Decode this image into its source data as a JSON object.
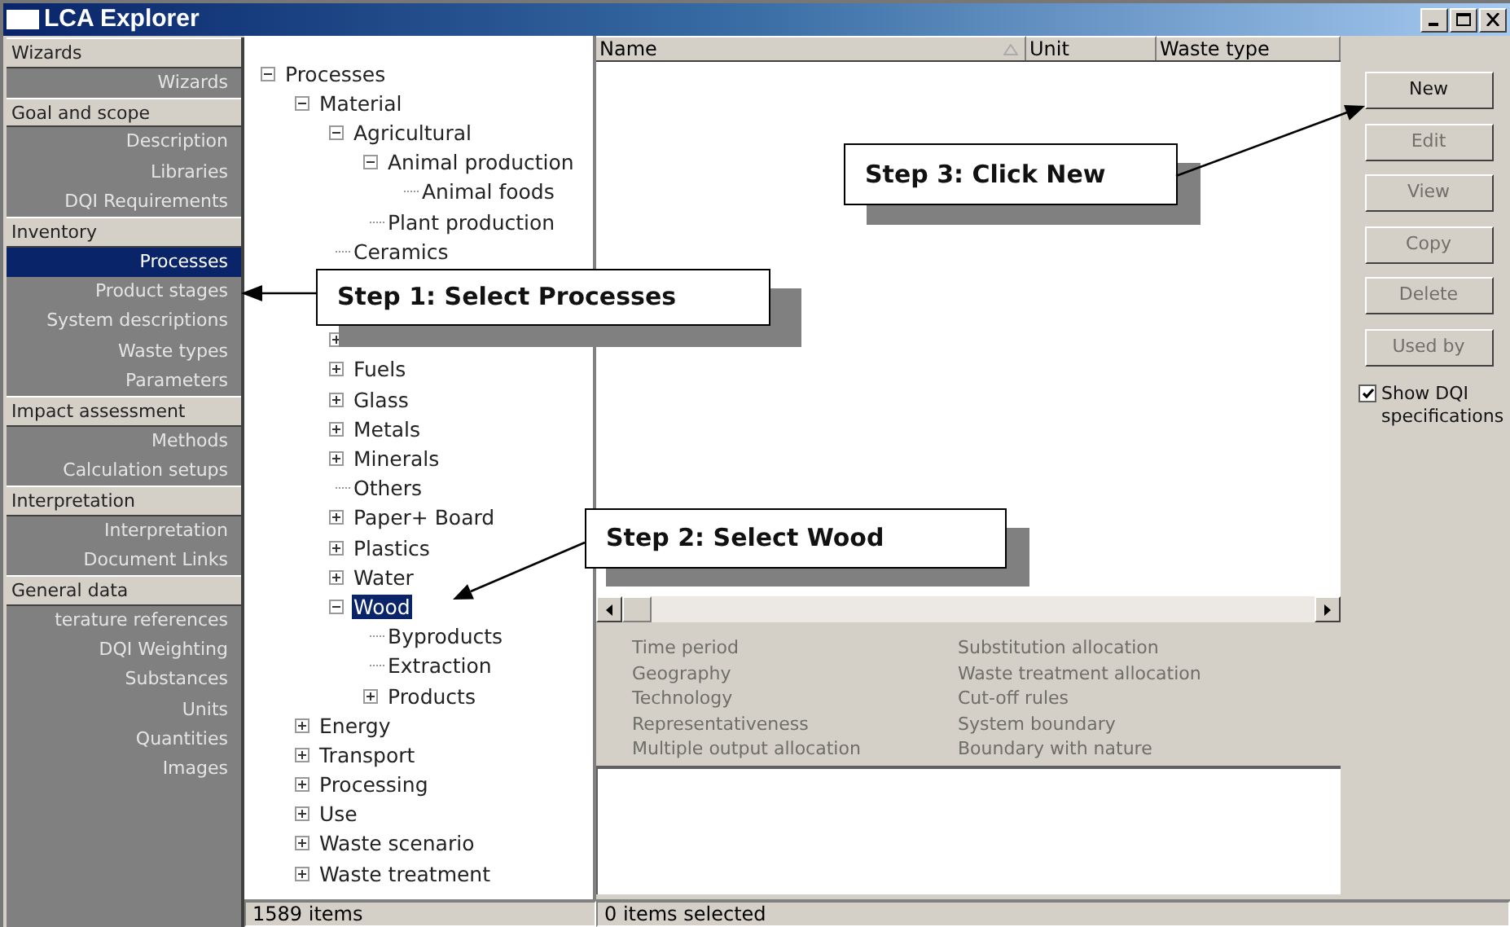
{
  "window": {
    "title": "LCA Explorer"
  },
  "sidebar": [
    {
      "title": "Wizards",
      "items": [
        {
          "label": "Wizards",
          "selected": false
        }
      ]
    },
    {
      "title": "Goal and scope",
      "items": [
        {
          "label": "Description",
          "selected": false
        },
        {
          "label": "Libraries",
          "selected": false
        },
        {
          "label": "DQI Requirements",
          "selected": false
        }
      ]
    },
    {
      "title": "Inventory",
      "items": [
        {
          "label": "Processes",
          "selected": true
        },
        {
          "label": "Product stages",
          "selected": false
        },
        {
          "label": "System descriptions",
          "selected": false
        },
        {
          "label": "Waste types",
          "selected": false
        },
        {
          "label": "Parameters",
          "selected": false
        }
      ]
    },
    {
      "title": "Impact assessment",
      "items": [
        {
          "label": "Methods",
          "selected": false
        },
        {
          "label": "Calculation setups",
          "selected": false
        }
      ]
    },
    {
      "title": "Interpretation",
      "items": [
        {
          "label": "Interpretation",
          "selected": false
        },
        {
          "label": "Document Links",
          "selected": false
        }
      ]
    },
    {
      "title": "General data",
      "items": [
        {
          "label": "terature references",
          "selected": false
        },
        {
          "label": "DQI Weighting",
          "selected": false
        },
        {
          "label": "Substances",
          "selected": false
        },
        {
          "label": "Units",
          "selected": false
        },
        {
          "label": "Quantities",
          "selected": false
        },
        {
          "label": "Images",
          "selected": false
        }
      ]
    }
  ],
  "tree": [
    {
      "kind": "item",
      "label": "Processes",
      "selected": false,
      "expanded": true,
      "children": [
        {
          "kind": "item",
          "label": "Material",
          "selected": false,
          "expanded": true,
          "children": [
            {
              "kind": "item",
              "label": "Agricultural",
              "selected": false,
              "expanded": true,
              "children": [
                {
                  "kind": "item",
                  "label": "Animal production",
                  "selected": false,
                  "expanded": true,
                  "children": [
                    {
                      "kind": "item",
                      "label": "Animal foods",
                      "selected": false
                    }
                  ]
                },
                {
                  "kind": "item",
                  "label": "Plant production",
                  "selected": false
                }
              ]
            },
            {
              "kind": "item",
              "label": "Ceramics",
              "selected": false
            },
            {
              "kind": "covered"
            },
            {
              "kind": "covered"
            },
            {
              "kind": "covered",
              "expanded": false
            },
            {
              "kind": "item",
              "label": "Fuels",
              "selected": false,
              "expanded": false
            },
            {
              "kind": "item",
              "label": "Glass",
              "selected": false,
              "expanded": false
            },
            {
              "kind": "item",
              "label": "Metals",
              "selected": false,
              "expanded": false
            },
            {
              "kind": "item",
              "label": "Minerals",
              "selected": false,
              "expanded": false
            },
            {
              "kind": "item",
              "label": "Others",
              "selected": false
            },
            {
              "kind": "item",
              "label": "Paper+ Board",
              "selected": false,
              "expanded": false
            },
            {
              "kind": "item",
              "label": "Plastics",
              "selected": false,
              "expanded": false
            },
            {
              "kind": "item",
              "label": "Water",
              "selected": false,
              "expanded": false
            },
            {
              "kind": "item",
              "label": "Wood",
              "selected": true,
              "expanded": true,
              "children": [
                {
                  "kind": "item",
                  "label": "Byproducts",
                  "selected": false
                },
                {
                  "kind": "item",
                  "label": "Extraction",
                  "selected": false
                },
                {
                  "kind": "item",
                  "label": "Products",
                  "selected": false,
                  "expanded": false
                }
              ]
            }
          ]
        },
        {
          "kind": "item",
          "label": "Energy",
          "selected": false,
          "expanded": false
        },
        {
          "kind": "item",
          "label": "Transport",
          "selected": false,
          "expanded": false
        },
        {
          "kind": "item",
          "label": "Processing",
          "selected": false,
          "expanded": false
        },
        {
          "kind": "item",
          "label": "Use",
          "selected": false,
          "expanded": false
        },
        {
          "kind": "item",
          "label": "Waste scenario",
          "selected": false,
          "expanded": false
        },
        {
          "kind": "item",
          "label": "Waste treatment",
          "selected": false,
          "expanded": false
        }
      ]
    }
  ],
  "table": {
    "columns": [
      {
        "label": "Name",
        "sorted": true
      },
      {
        "label": "Unit",
        "sorted": false
      },
      {
        "label": "Waste type",
        "sorted": false
      }
    ]
  },
  "dqi_fields": [
    [
      "Time period",
      "Geography",
      "Technology",
      "Representativeness",
      "Multiple output allocation"
    ],
    [
      "Substitution allocation",
      "Waste treatment allocation",
      "Cut-off rules",
      "System boundary",
      "Boundary with nature"
    ]
  ],
  "buttons": [
    {
      "label": "New",
      "disabled": false
    },
    {
      "label": "Edit",
      "disabled": true
    },
    {
      "label": "View",
      "disabled": true
    },
    {
      "label": "Copy",
      "disabled": true
    },
    {
      "label": "Delete",
      "disabled": true
    },
    {
      "label": "Used by",
      "disabled": true
    }
  ],
  "show_dqi": {
    "label": "Show DQI specifications",
    "checked": true
  },
  "status_bar": {
    "tree": "1589 items",
    "list": "0 items selected"
  },
  "callouts": [
    {
      "text": "Step 1: Select Processes"
    },
    {
      "text": "Step 2: Select Wood"
    },
    {
      "text": "Step 3: Click New"
    }
  ]
}
